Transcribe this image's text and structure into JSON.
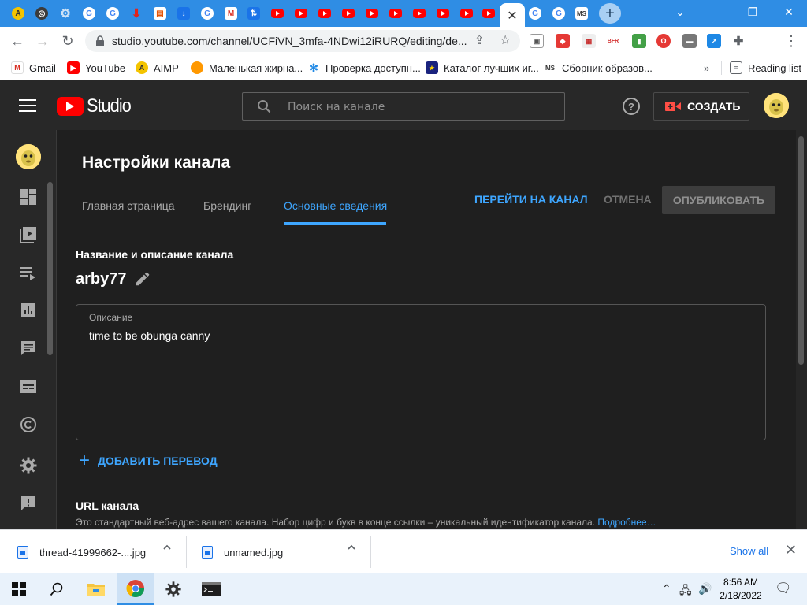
{
  "browser": {
    "address_url": "studio.youtube.com/channel/UCFiVN_3mfa-4NDwi12iRURQ/editing/de...",
    "new_tab": "+",
    "bookmarks": [
      {
        "label": "Gmail",
        "icon": "gmail-icon"
      },
      {
        "label": "YouTube",
        "icon": "youtube-icon"
      },
      {
        "label": "AIMP",
        "icon": "aimp-icon"
      },
      {
        "label": "Маленькая жирна...",
        "icon": "orange-blob-icon"
      },
      {
        "label": "Проверка доступн...",
        "icon": "gear-blue-icon"
      },
      {
        "label": "Каталог лучших иг...",
        "icon": "eu-flag-icon"
      },
      {
        "label": "Сборник образов...",
        "icon": "ms-icon"
      }
    ],
    "more_bookmarks": "»",
    "reading_list": "Reading list"
  },
  "header": {
    "logo_text": "Studio",
    "search_placeholder": "Поиск на канале",
    "help_glyph": "?",
    "create_label": "СОЗДАТЬ"
  },
  "page": {
    "title": "Настройки канала",
    "tabs": [
      {
        "label": "Главная страница"
      },
      {
        "label": "Брендинг"
      },
      {
        "label": "Основные сведения"
      }
    ],
    "go_to_channel": "ПЕРЕЙТИ НА КАНАЛ",
    "cancel": "ОТМЕНА",
    "publish": "ОПУБЛИКОВАТЬ",
    "name_section_title": "Название и описание канала",
    "channel_name": "arby77",
    "description_label": "Описание",
    "description_value": "time to be obunga canny",
    "add_translation": "ДОБАВИТЬ ПЕРЕВОД",
    "url_section_title": "URL канала",
    "url_section_desc": "Это стандартный веб-адрес вашего канала. Набор цифр и букв в конце ссылки – уникальный идентификатор канала.",
    "url_more_link": "Подробнее…"
  },
  "downloads": {
    "items": [
      {
        "name": "thread-41999662-....jpg"
      },
      {
        "name": "unnamed.jpg"
      }
    ],
    "show_all": "Show all"
  },
  "taskbar": {
    "time": "8:56 AM",
    "date": "2/18/2022"
  },
  "colors": {
    "accent_blue": "#3ea6ff",
    "youtube_red": "#ff0000",
    "studio_bg": "#282828",
    "content_bg": "#1f1f1f"
  }
}
